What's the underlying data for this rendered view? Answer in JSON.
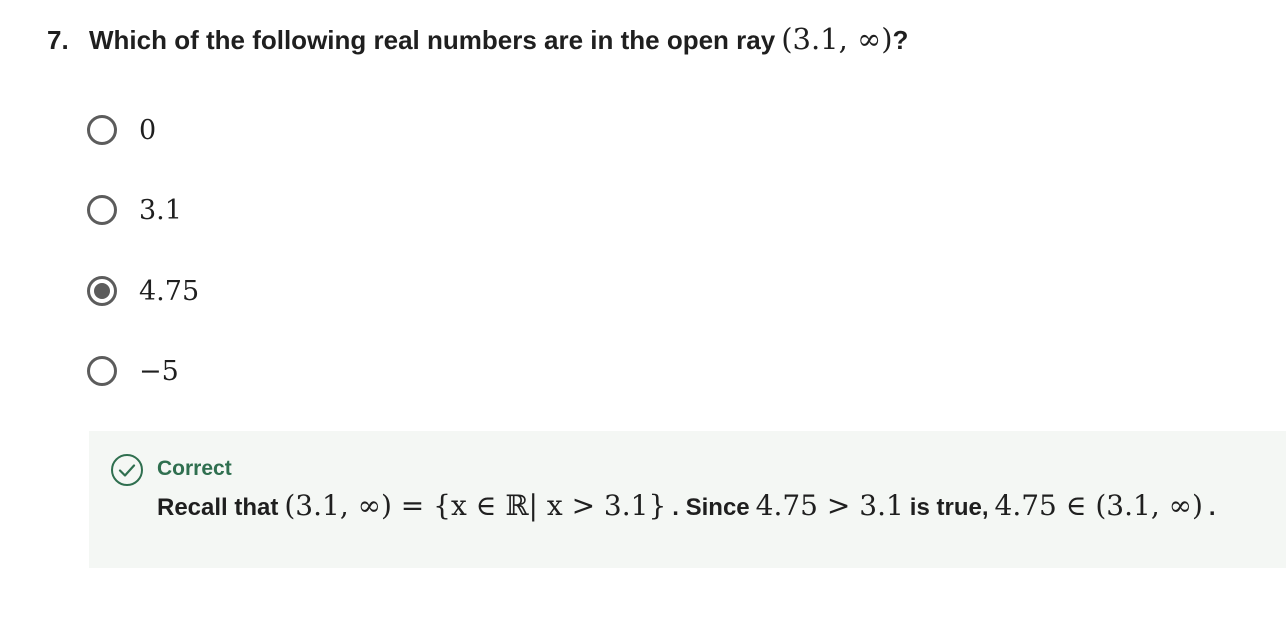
{
  "question": {
    "number": "7.",
    "text": "Which of the following real numbers are in the open ray",
    "math": "(3.1, ∞)",
    "suffix": "?"
  },
  "options": [
    {
      "label": "0",
      "selected": false
    },
    {
      "label": "3.1",
      "selected": false
    },
    {
      "label": "4.75",
      "selected": true
    },
    {
      "label": "−5",
      "selected": false
    }
  ],
  "feedback": {
    "status": "Correct",
    "icon": "check-circle-icon",
    "status_color": "#2f6f4f",
    "background": "#f4f7f4",
    "text_1": "Recall that",
    "math_1": "(3.1, ∞) = {x ∈ ℝ| x > 3.1}",
    "text_2": ". Since",
    "math_2": "4.75 > 3.1",
    "text_3": "is true,",
    "math_3": "4.75 ∈ (3.1, ∞)",
    "text_4": "."
  }
}
